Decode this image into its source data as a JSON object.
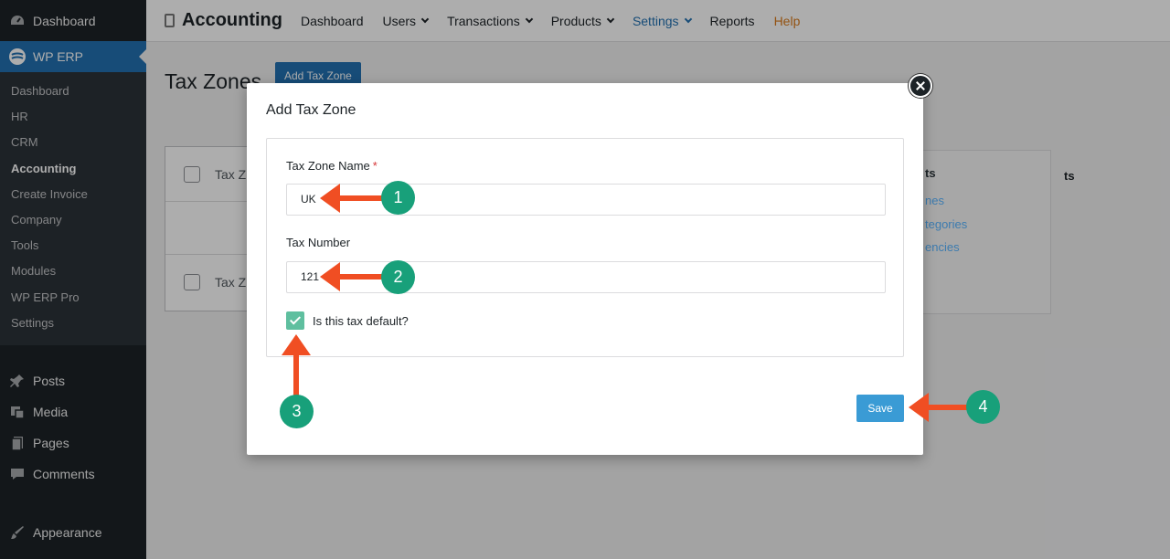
{
  "sidebar": {
    "top_item": "Dashboard",
    "active_item": "WP ERP",
    "sub_items": [
      "Dashboard",
      "HR",
      "CRM",
      "Accounting",
      "Create Invoice",
      "Company",
      "Tools",
      "Modules",
      "WP ERP Pro",
      "Settings"
    ],
    "current_sub": "Accounting",
    "bottom_items": [
      {
        "label": "Posts",
        "icon": "pin-icon"
      },
      {
        "label": "Media",
        "icon": "media-icon"
      },
      {
        "label": "Pages",
        "icon": "pages-icon"
      },
      {
        "label": "Comments",
        "icon": "comments-icon"
      },
      {
        "label": "Appearance",
        "icon": "brush-icon"
      }
    ]
  },
  "topnav": {
    "brand": "Accounting",
    "items": [
      "Dashboard",
      "Users",
      "Transactions",
      "Products",
      "Settings",
      "Reports",
      "Help"
    ]
  },
  "page": {
    "title": "Tax Zones",
    "add_button": "Add Tax Zone",
    "rows": [
      "Tax Z",
      "Tax Z"
    ],
    "side_panel": {
      "title": "ts",
      "links": [
        "nes",
        "tegories",
        "encies"
      ]
    }
  },
  "modal": {
    "title": "Add Tax Zone",
    "tax_zone_name_label": "Tax Zone Name",
    "required_mark": "*",
    "tax_zone_name_value": "UK",
    "tax_number_label": "Tax Number",
    "tax_number_value": "121",
    "default_checkbox_label": "Is this tax default?",
    "default_checked": true,
    "save_label": "Save"
  },
  "annotations": [
    "1",
    "2",
    "3",
    "4"
  ],
  "colors": {
    "arrow": "#f04e23",
    "badge": "#18a07a",
    "accent": "#2271b1"
  }
}
